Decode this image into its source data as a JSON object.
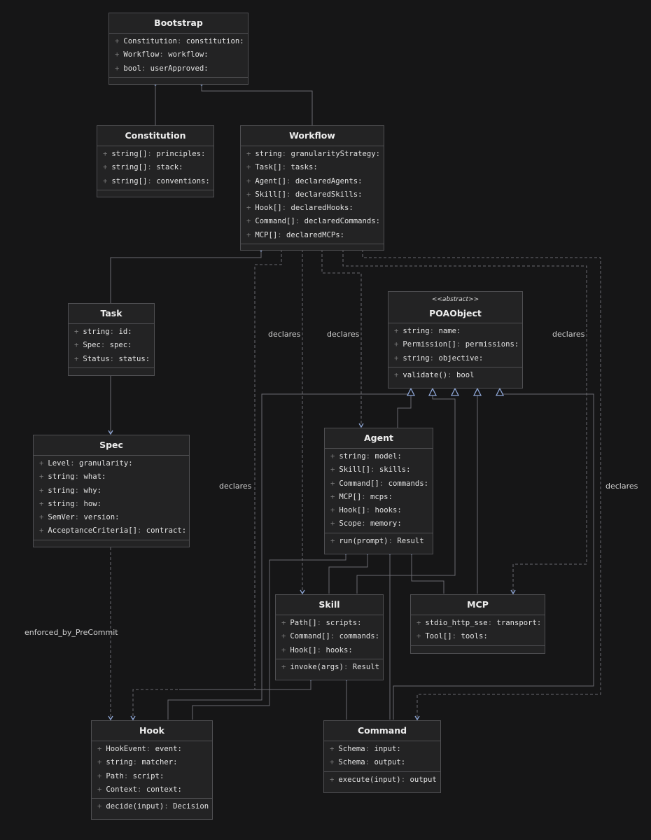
{
  "classes": {
    "bootstrap": {
      "title": "Bootstrap",
      "fields": [
        {
          "type": "Constitution",
          "name": "constitution:"
        },
        {
          "type": "Workflow",
          "name": "workflow:"
        },
        {
          "type": "bool",
          "name": "userApproved:"
        }
      ],
      "methods": []
    },
    "constitution": {
      "title": "Constitution",
      "fields": [
        {
          "type": "string[]",
          "name": "principles:"
        },
        {
          "type": "string[]",
          "name": "stack:"
        },
        {
          "type": "string[]",
          "name": "conventions:"
        }
      ],
      "methods": []
    },
    "workflow": {
      "title": "Workflow",
      "fields": [
        {
          "type": "string",
          "name": "granularityStrategy:"
        },
        {
          "type": "Task[]",
          "name": "tasks:"
        },
        {
          "type": "Agent[]",
          "name": "declaredAgents:"
        },
        {
          "type": "Skill[]",
          "name": "declaredSkills:"
        },
        {
          "type": "Hook[]",
          "name": "declaredHooks:"
        },
        {
          "type": "Command[]",
          "name": "declaredCommands:"
        },
        {
          "type": "MCP[]",
          "name": "declaredMCPs:"
        }
      ],
      "methods": []
    },
    "task": {
      "title": "Task",
      "fields": [
        {
          "type": "string",
          "name": "id:"
        },
        {
          "type": "Spec",
          "name": "spec:"
        },
        {
          "type": "Status",
          "name": "status:"
        }
      ],
      "methods": []
    },
    "poaobject": {
      "stereotype": "<<abstract>>",
      "title": "POAObject",
      "fields": [
        {
          "type": "string",
          "name": "name:"
        },
        {
          "type": "Permission[]",
          "name": "permissions:"
        },
        {
          "type": "string",
          "name": "objective:"
        }
      ],
      "methods": [
        {
          "type": "validate()",
          "name": "bool"
        }
      ]
    },
    "spec": {
      "title": "Spec",
      "fields": [
        {
          "type": "Level",
          "name": "granularity:"
        },
        {
          "type": "string",
          "name": "what:"
        },
        {
          "type": "string",
          "name": "why:"
        },
        {
          "type": "string",
          "name": "how:"
        },
        {
          "type": "SemVer",
          "name": "version:"
        },
        {
          "type": "AcceptanceCriteria[]",
          "name": "contract:"
        }
      ],
      "methods": []
    },
    "agent": {
      "title": "Agent",
      "fields": [
        {
          "type": "string",
          "name": "model:"
        },
        {
          "type": "Skill[]",
          "name": "skills:"
        },
        {
          "type": "Command[]",
          "name": "commands:"
        },
        {
          "type": "MCP[]",
          "name": "mcps:"
        },
        {
          "type": "Hook[]",
          "name": "hooks:"
        },
        {
          "type": "Scope",
          "name": "memory:"
        }
      ],
      "methods": [
        {
          "type": "run(prompt)",
          "name": "Result"
        }
      ]
    },
    "skill": {
      "title": "Skill",
      "fields": [
        {
          "type": "Path[]",
          "name": "scripts:"
        },
        {
          "type": "Command[]",
          "name": "commands:"
        },
        {
          "type": "Hook[]",
          "name": "hooks:"
        }
      ],
      "methods": [
        {
          "type": "invoke(args)",
          "name": "Result"
        }
      ]
    },
    "mcp": {
      "title": "MCP",
      "fields": [
        {
          "type": "stdio_http_sse",
          "name": "transport:"
        },
        {
          "type": "Tool[]",
          "name": "tools:"
        }
      ],
      "methods": []
    },
    "hook": {
      "title": "Hook",
      "fields": [
        {
          "type": "HookEvent",
          "name": "event:"
        },
        {
          "type": "string",
          "name": "matcher:"
        },
        {
          "type": "Path",
          "name": "script:"
        },
        {
          "type": "Context",
          "name": "context:"
        }
      ],
      "methods": [
        {
          "type": "decide(input)",
          "name": "Decision"
        }
      ]
    },
    "command": {
      "title": "Command",
      "fields": [
        {
          "type": "Schema",
          "name": "input:"
        },
        {
          "type": "Schema",
          "name": "output:"
        }
      ],
      "methods": [
        {
          "type": "execute(input)",
          "name": "output"
        }
      ]
    }
  },
  "relation_labels": {
    "declares": "declares",
    "enforced": "enforced_by_PreCommit"
  },
  "colors": {
    "background": "#161617",
    "node_fill": "#232324",
    "node_border": "#4f4f52",
    "line": "#6b6b70",
    "arrow": "#8ea6d6"
  }
}
